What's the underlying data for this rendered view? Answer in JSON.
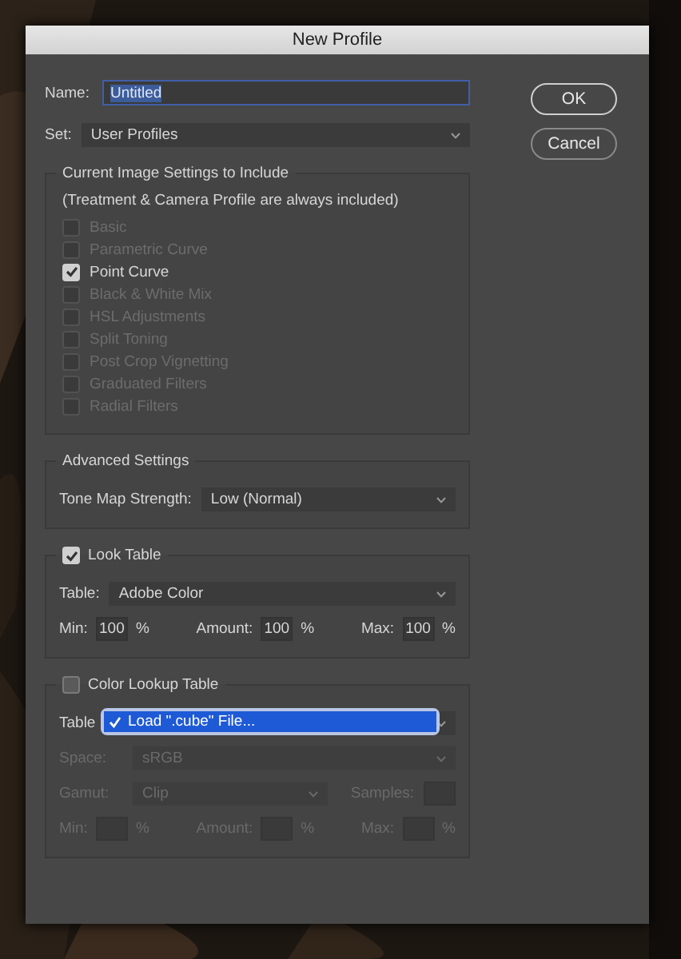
{
  "window": {
    "title": "New Profile"
  },
  "name_field": {
    "label": "Name:",
    "value": "Untitled"
  },
  "set_field": {
    "label": "Set:",
    "value": "User Profiles"
  },
  "buttons": [
    {
      "label": "OK",
      "kind": "default"
    },
    {
      "label": "Cancel",
      "kind": "normal"
    }
  ],
  "current_settings": {
    "title": "Current Image Settings to Include",
    "note": "(Treatment & Camera Profile are always included)",
    "items": [
      {
        "label": "Basic",
        "checked": false,
        "disabled": true
      },
      {
        "label": "Parametric Curve",
        "checked": false,
        "disabled": true
      },
      {
        "label": "Point Curve",
        "checked": true,
        "disabled": false
      },
      {
        "label": "Black & White Mix",
        "checked": false,
        "disabled": true
      },
      {
        "label": "HSL Adjustments",
        "checked": false,
        "disabled": true
      },
      {
        "label": "Split Toning",
        "checked": false,
        "disabled": true
      },
      {
        "label": "Post Crop Vignetting",
        "checked": false,
        "disabled": true
      },
      {
        "label": "Graduated Filters",
        "checked": false,
        "disabled": true
      },
      {
        "label": "Radial Filters",
        "checked": false,
        "disabled": true
      }
    ]
  },
  "advanced": {
    "title": "Advanced Settings",
    "tone_map": {
      "label": "Tone Map Strength:",
      "value": "Low (Normal)"
    }
  },
  "look_table": {
    "title": "Look Table",
    "checked": true,
    "table": {
      "label": "Table:",
      "value": "Adobe Color"
    },
    "amounts": [
      {
        "label": "Min:",
        "value": "100",
        "unit": "%"
      },
      {
        "label": "Amount:",
        "value": "100",
        "unit": "%"
      },
      {
        "label": "Max:",
        "value": "100",
        "unit": "%"
      }
    ]
  },
  "color_lookup": {
    "title": "Color Lookup Table",
    "checked": false,
    "disabled": true,
    "table_label": "Table",
    "menu": [
      {
        "label": "Load \".cube\" File...",
        "selected": true
      }
    ],
    "space": {
      "label": "Space:",
      "value": "sRGB"
    },
    "gamut": {
      "label": "Gamut:",
      "value": "Clip"
    },
    "samples": {
      "label": "Samples:"
    },
    "amounts": [
      {
        "label": "Min:",
        "unit": "%"
      },
      {
        "label": "Amount:",
        "unit": "%"
      },
      {
        "label": "Max:",
        "unit": "%"
      }
    ]
  }
}
